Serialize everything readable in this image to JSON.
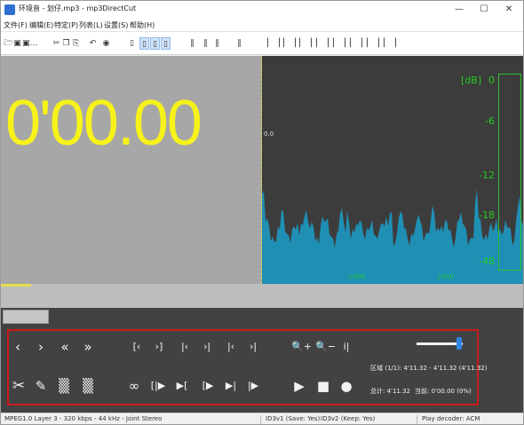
{
  "window": {
    "title": "环境音 - 划仔.mp3 - mp3DirectCut",
    "minimize": "—",
    "maximize": "☐",
    "close": "✕"
  },
  "menu": [
    "文件(F)",
    "编辑(E)",
    "特定(P)",
    "列表(L)",
    "设置(S)",
    "帮助(H)"
  ],
  "display": {
    "time": "0'00.00",
    "cursor_label": "0.0",
    "db_title": "[dB]",
    "db_scale": [
      "0",
      "-6",
      "-12",
      "-18",
      "-48"
    ],
    "time_ticks": [
      "|:005",
      "|:010"
    ],
    "time_panel_color": "#a7a7a7",
    "time_color": "#f6f21a",
    "wave_color": "#1f8fb4",
    "db_color": "#22cc22"
  },
  "controls": {
    "nav": [
      "‹",
      "›",
      "«",
      "»"
    ],
    "bracket_nav": [
      "[‹",
      "›]",
      "|‹",
      "›|",
      "|‹",
      "›|"
    ],
    "zoom": [
      "🔍+",
      "🔍−",
      "i|"
    ],
    "edit": [
      "✂",
      "✎",
      "▒",
      "▒"
    ],
    "loop": "∞",
    "play_sel": [
      "[|▶",
      "▶[",
      "[▶",
      "▶|",
      "|▶"
    ],
    "transport": {
      "play": "▶",
      "stop": "■",
      "record": "●"
    },
    "volume_fraction": 0.92,
    "selection_info": "区域 (1/1): 4'11.32 - 4'11.32 (4'11.32)",
    "total_info": "总计: 4'11.32",
    "current_info": "当前: 0'00.00 (0%)",
    "frame_color": "#cc1b1b"
  },
  "statusbar": {
    "format": "MPEG1.0 Layer 3 - 320 kbps - 44 kHz - Joint Stereo",
    "id3v1": "ID3v1 (Save: Yes)",
    "id3v2": "ID3v2 (Keep: Yes)",
    "decoder": "Play decoder: ACM"
  },
  "icons": {
    "toolbar": [
      "open-file-icon",
      "save-icon",
      "save-as-icon",
      "cut-icon",
      "copy-icon",
      "paste-icon",
      "undo-icon",
      "record-icon",
      "page-icon",
      "page-icon",
      "page-icon",
      "page-icon",
      "bars-icon",
      "pause-icon",
      "bars-icon",
      "bars-icon",
      "marker-icon",
      "marker-icon",
      "marker-icon",
      "marker-icon",
      "marker-icon",
      "marker-icon",
      "marker-icon",
      "marker-icon"
    ]
  }
}
